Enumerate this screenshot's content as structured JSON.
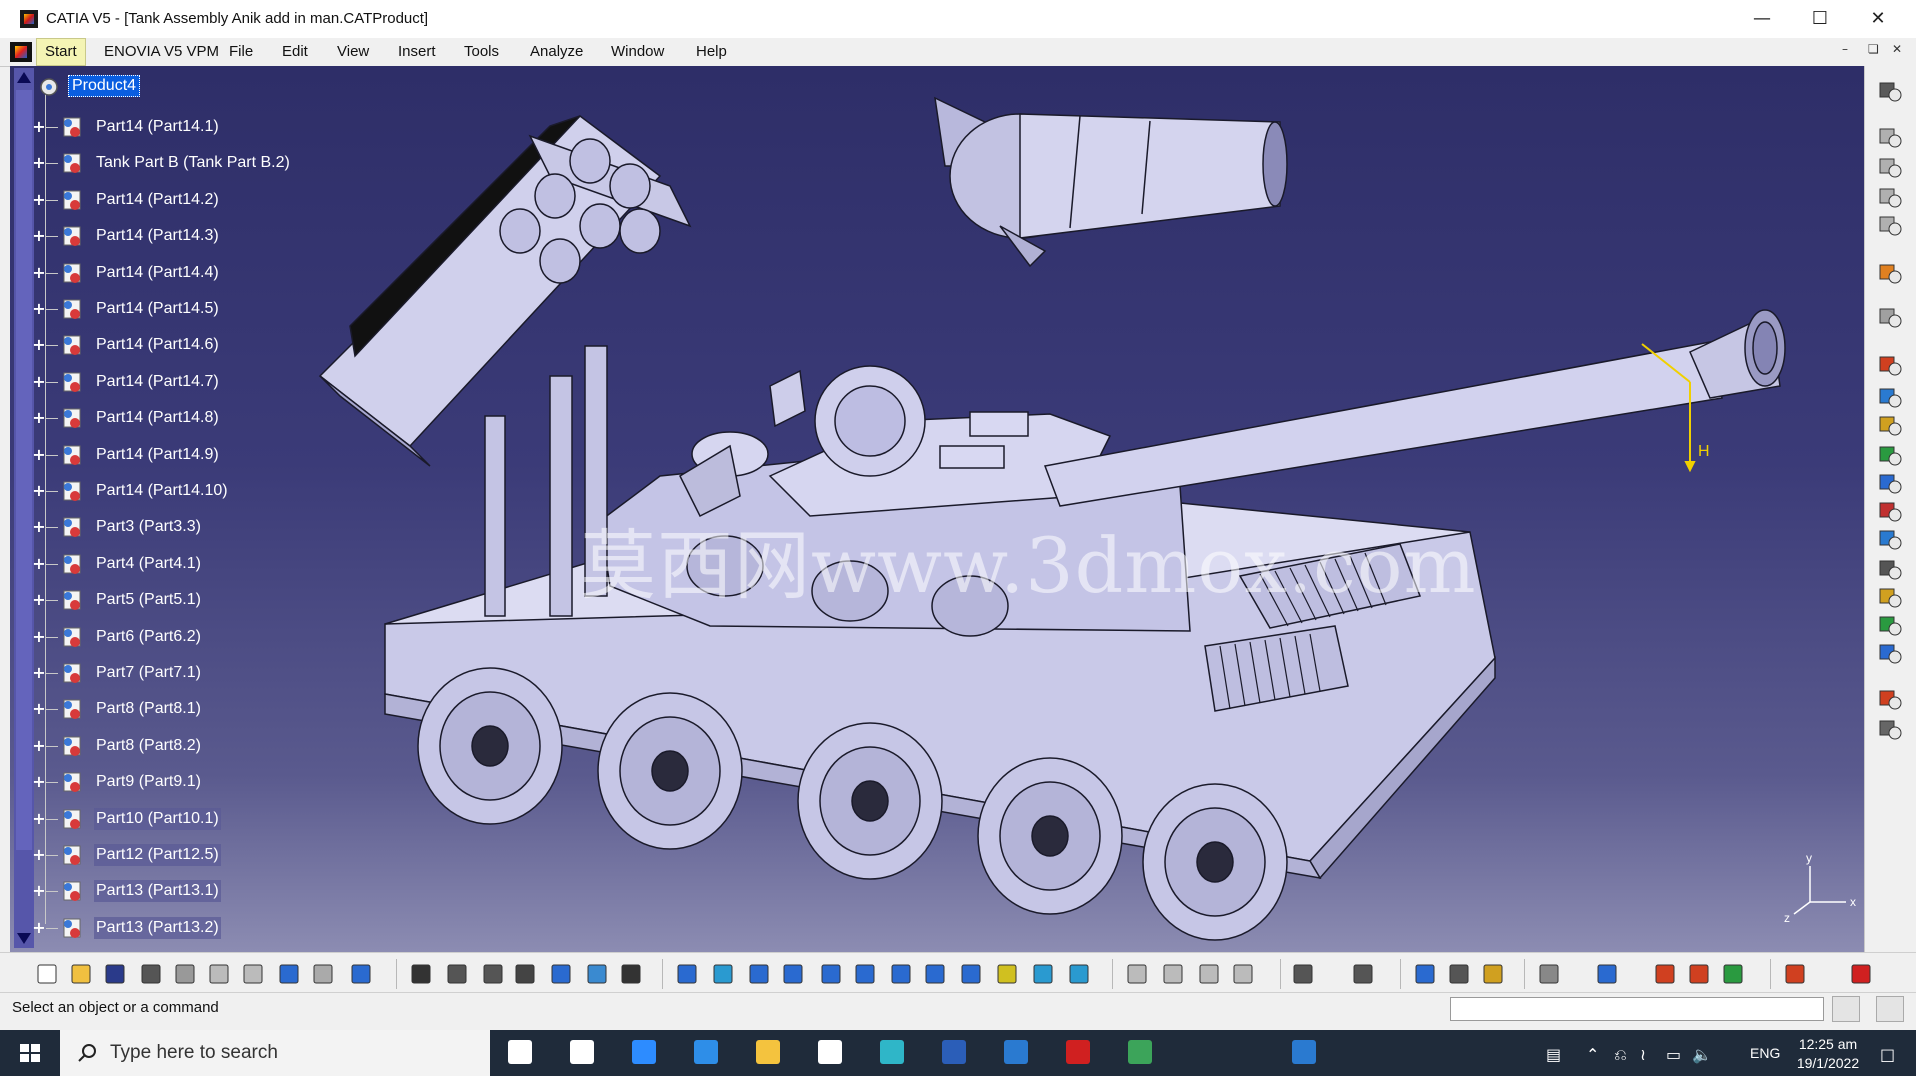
{
  "window": {
    "title": "CATIA V5 - [Tank Assembly Anik add in man.CATProduct]"
  },
  "menubar": {
    "items": [
      {
        "id": "start",
        "label": "Start"
      },
      {
        "id": "enovia",
        "label": "ENOVIA V5 VPM"
      },
      {
        "id": "file",
        "label": "File"
      },
      {
        "id": "edit",
        "label": "Edit"
      },
      {
        "id": "view",
        "label": "View"
      },
      {
        "id": "insert",
        "label": "Insert"
      },
      {
        "id": "tools",
        "label": "Tools"
      },
      {
        "id": "analyze",
        "label": "Analyze"
      },
      {
        "id": "window",
        "label": "Window"
      },
      {
        "id": "help",
        "label": "Help"
      }
    ]
  },
  "tree": {
    "root": "Product4",
    "items": [
      "Part14 (Part14.1)",
      "Tank Part B (Tank Part B.2)",
      "Part14 (Part14.2)",
      "Part14 (Part14.3)",
      "Part14 (Part14.4)",
      "Part14 (Part14.5)",
      "Part14 (Part14.6)",
      "Part14 (Part14.7)",
      "Part14 (Part14.8)",
      "Part14 (Part14.9)",
      "Part14 (Part14.10)",
      "Part3 (Part3.3)",
      "Part4 (Part4.1)",
      "Part5 (Part5.1)",
      "Part6 (Part6.2)",
      "Part7 (Part7.1)",
      "Part8 (Part8.1)",
      "Part8 (Part8.2)",
      "Part9 (Part9.1)",
      "Part10 (Part10.1)",
      "Part12 (Part12.5)",
      "Part13 (Part13.1)",
      "Part13 (Part13.2)"
    ]
  },
  "viewport": {
    "watermark": "莫西网www.3dmox.com",
    "dimension_label": "H",
    "axis_labels": {
      "x": "x",
      "y": "y",
      "z": "z"
    }
  },
  "statusbar": {
    "message": "Select an object or a command"
  },
  "taskbar": {
    "search_placeholder": "Type here to search",
    "language": "ENG",
    "time": "12:25 am",
    "date": "19/1/2022"
  }
}
